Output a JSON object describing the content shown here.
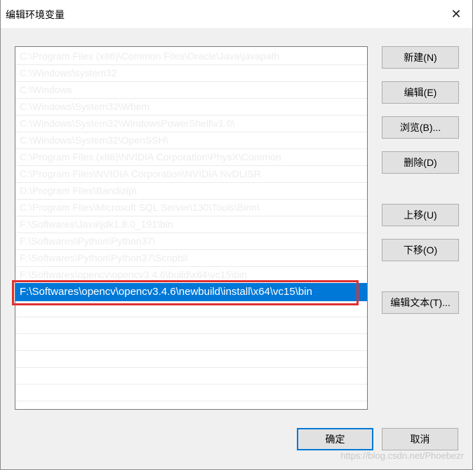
{
  "window": {
    "title": "编辑环境变量",
    "close_glyph": "✕"
  },
  "list": {
    "items": [
      "C:\\Program Files (x86)\\Common Files\\Oracle\\Java\\javapath",
      "C:\\Windows\\system32",
      "C:\\Windows",
      "C:\\Windows\\System32\\Wbem",
      "C:\\Windows\\System32\\WindowsPowerShell\\v1.0\\",
      "C:\\Windows\\System32\\OpenSSH\\",
      "C:\\Program Files (x86)\\NVIDIA Corporation\\PhysX\\Common",
      "C:\\Program Files\\NVIDIA Corporation\\NVIDIA NvDLISR",
      "D:\\Program Files\\Bandizip\\",
      "C:\\Program Files\\Microsoft SQL Server\\130\\Tools\\Binn\\",
      "F:\\Softwares\\Java\\jdk1.8.0_191\\bin",
      "F:\\Softwares\\Python\\Python37\\",
      "F:\\Softwares\\Python\\Python37\\Scripts\\",
      "F:\\Softwares\\opencv\\opencv3.4.6\\build\\x64\\vc15\\bin",
      "F:\\Softwares\\opencv\\opencv3.4.6\\newbuild\\install\\x64\\vc15\\bin"
    ],
    "selected_index": 14,
    "empty_rows": 7
  },
  "buttons": {
    "new": "新建(N)",
    "edit": "编辑(E)",
    "browse": "浏览(B)...",
    "delete": "删除(D)",
    "move_up": "上移(U)",
    "move_down": "下移(O)",
    "edit_text": "编辑文本(T)...",
    "ok": "确定",
    "cancel": "取消"
  },
  "watermark": "https://blog.csdn.net/Phoebezr"
}
